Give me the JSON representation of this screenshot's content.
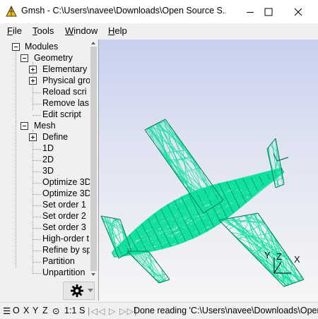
{
  "window": {
    "title": "Gmsh - C:\\Users\\navee\\Downloads\\Open Source S..."
  },
  "menu": {
    "file": {
      "u": "F",
      "rest": "ile"
    },
    "tools": {
      "u": "T",
      "rest": "ools"
    },
    "window": {
      "u": "W",
      "rest": "indow"
    },
    "help": {
      "u": "H",
      "rest": "elp"
    }
  },
  "tree": {
    "modules": "Modules",
    "geometry": "Geometry",
    "geometry_items": [
      "Elementary",
      "Physical gro",
      "Reload scri",
      "Remove las",
      "Edit script"
    ],
    "mesh": "Mesh",
    "mesh_items": [
      "Define",
      "1D",
      "2D",
      "3D",
      "Optimize 3D",
      "Optimize 3D",
      "Set order 1",
      "Set order 2",
      "Set order 3",
      "High-order t",
      "Refine by sp",
      "Partition",
      "Unpartition"
    ]
  },
  "axes": {
    "x": "X",
    "y": "Y",
    "z": "Z"
  },
  "status": {
    "menu_glyph": "☰",
    "o": "O",
    "x": "X",
    "y": "Y",
    "z": "Z",
    "rotate": "⊙",
    "scale": "1:1",
    "s": "S",
    "nav": "|◁◁ ▷ ▷▷|",
    "message": "Done reading 'C:\\Users\\navee\\Downloads\\Open"
  },
  "colors": {
    "mesh": "#10e0a0",
    "mesh_dark": "#0a7a55",
    "bg_top": "#c8d0ee",
    "bg_bottom": "#f6f6f6"
  }
}
